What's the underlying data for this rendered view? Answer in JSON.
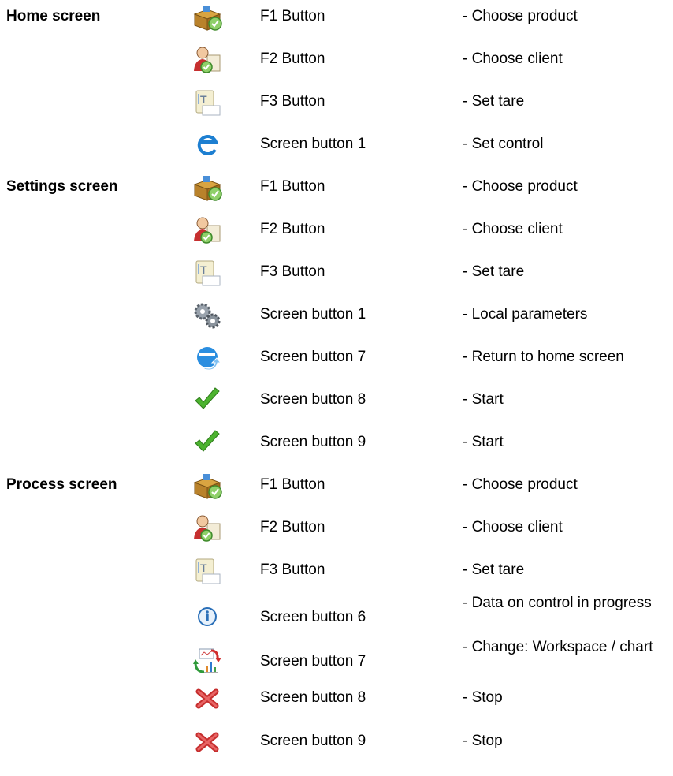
{
  "sections": {
    "home": "Home screen",
    "settings": "Settings screen",
    "process": "Process screen"
  },
  "rows": [
    {
      "icon": "product-box-icon",
      "button": "F1 Button",
      "desc": "- Choose product"
    },
    {
      "icon": "client-icon",
      "button": "F2 Button",
      "desc": "- Choose client"
    },
    {
      "icon": "tare-icon",
      "button": "F3 Button",
      "desc": "- Set tare"
    },
    {
      "icon": "control-e-icon",
      "button": "Screen button 1",
      "desc": "- Set control"
    },
    {
      "icon": "product-box-icon",
      "button": "F1 Button",
      "desc": "- Choose product"
    },
    {
      "icon": "client-icon",
      "button": "F2 Button",
      "desc": "- Choose client"
    },
    {
      "icon": "tare-icon",
      "button": "F3 Button",
      "desc": "- Set tare"
    },
    {
      "icon": "gears-icon",
      "button": "Screen button 1",
      "desc": "- Local parameters"
    },
    {
      "icon": "return-home-icon",
      "button": "Screen button 7",
      "desc": "- Return to home screen"
    },
    {
      "icon": "checkmark-icon",
      "button": "Screen button 8",
      "desc": "- Start"
    },
    {
      "icon": "checkmark-icon",
      "button": "Screen button 9",
      "desc": "- Start"
    },
    {
      "icon": "product-box-icon",
      "button": "F1 Button",
      "desc": "- Choose product"
    },
    {
      "icon": "client-icon",
      "button": "F2 Button",
      "desc": "- Choose client"
    },
    {
      "icon": "tare-icon",
      "button": "F3 Button",
      "desc": "- Set tare"
    },
    {
      "icon": "info-icon",
      "button": "Screen button 6",
      "desc": "- Data on control in progress"
    },
    {
      "icon": "workspace-chart-switch-icon",
      "button": "Screen button 7",
      "desc": "- Change: Workspace / chart"
    },
    {
      "icon": "stop-x-icon",
      "button": "Screen button 8",
      "desc": "- Stop"
    },
    {
      "icon": "stop-x-icon",
      "button": "Screen button 9",
      "desc": "- Stop"
    }
  ]
}
